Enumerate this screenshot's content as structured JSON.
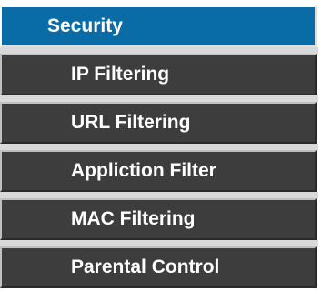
{
  "menu": {
    "header_label": "Security",
    "items": [
      {
        "label": "IP Filtering"
      },
      {
        "label": "URL Filtering"
      },
      {
        "label": "Appliction Filter"
      },
      {
        "label": "MAC Filtering"
      },
      {
        "label": "Parental Control"
      }
    ]
  },
  "colors": {
    "header_bg": "#0a6ca6",
    "item_bg": "#3d3d3d",
    "text": "#ffffff",
    "separator": "#d9d9d9"
  }
}
